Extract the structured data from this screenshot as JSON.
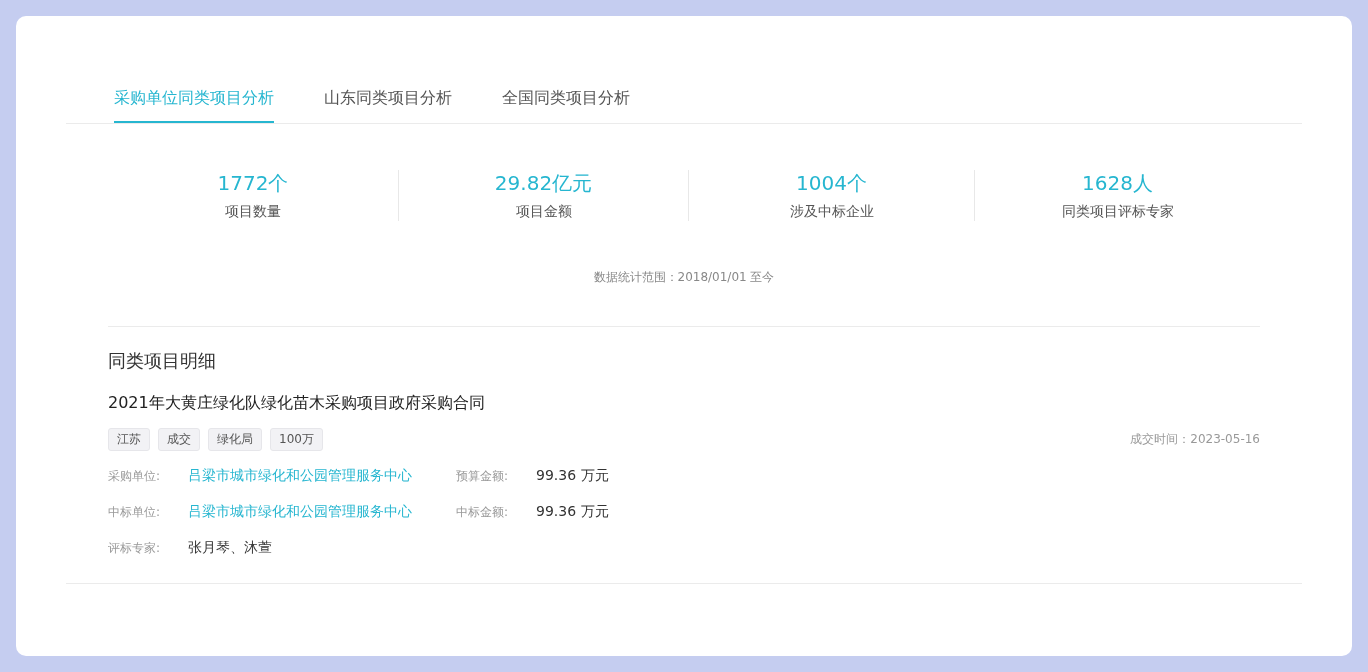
{
  "tabs": [
    {
      "label": "采购单位同类项目分析",
      "selected": true
    },
    {
      "label": "山东同类项目分析",
      "selected": false
    },
    {
      "label": "全国同类项目分析",
      "selected": false
    }
  ],
  "stats": [
    {
      "value": "1772个",
      "label": "项目数量"
    },
    {
      "value": "29.82亿元",
      "label": "项目金额"
    },
    {
      "value": "1004个",
      "label": "涉及中标企业"
    },
    {
      "value": "1628人",
      "label": "同类项目评标专家"
    }
  ],
  "date_range": "数据统计范围：2018/01/01 至今",
  "section_title": "同类项目明细",
  "project": {
    "title": "2021年大黄庄绿化队绿化苗木采购项目政府采购合同",
    "tags": [
      "江苏",
      "成交",
      "绿化局",
      "100万"
    ],
    "deal_time": "成交时间：2023-05-16",
    "rows": [
      [
        {
          "label": "采购单位:",
          "value": "吕梁市城市绿化和公园管理服务中心",
          "kind": "link"
        },
        {
          "label": "预算金额:",
          "value": "99.36 万元",
          "kind": "text"
        }
      ],
      [
        {
          "label": "中标单位:",
          "value": "吕梁市城市绿化和公园管理服务中心",
          "kind": "link"
        },
        {
          "label": "中标金额:",
          "value": "99.36 万元",
          "kind": "text"
        }
      ],
      [
        {
          "label": "评标专家:",
          "value": "张月琴、沐萱",
          "kind": "text"
        }
      ]
    ]
  }
}
